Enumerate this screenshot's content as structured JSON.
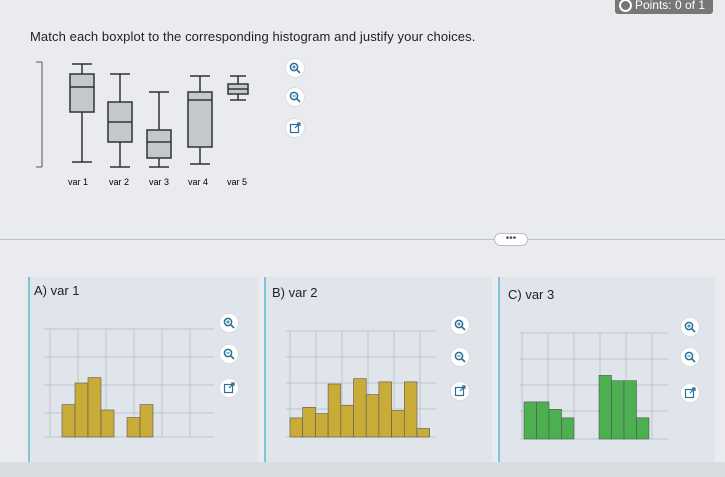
{
  "header": {
    "points": "Points: 0 of 1"
  },
  "question": "Match each boxplot to the corresponding histogram and justify your choices.",
  "boxplots": {
    "labels": [
      "var 1",
      "var 2",
      "var 3",
      "var 4",
      "var 5"
    ],
    "colors": {
      "box": "#c4c8cc",
      "line": "#333333"
    }
  },
  "more_button": "•••",
  "panels": [
    {
      "label": "A) var 1",
      "bar_color": "#c9ac38",
      "bar_fractions": [
        0.3,
        0.5,
        0.55,
        0.25,
        0,
        0.18,
        0.3
      ]
    },
    {
      "label": "B) var 2",
      "bar_color": "#c9ac38",
      "bar_fractions": [
        0.18,
        0.28,
        0.22,
        0.5,
        0.3,
        0.55,
        0.4,
        0.52,
        0.25,
        0.52,
        0.08
      ]
    },
    {
      "label": "C) var 3",
      "bar_color": "#4caf50",
      "bar_fractions": [
        0.35,
        0.35,
        0.28,
        0.2,
        0,
        0,
        0.6,
        0.55,
        0.55,
        0.2
      ]
    }
  ],
  "icons": [
    "zoom-in-icon",
    "zoom-out-icon",
    "external-link-icon"
  ]
}
